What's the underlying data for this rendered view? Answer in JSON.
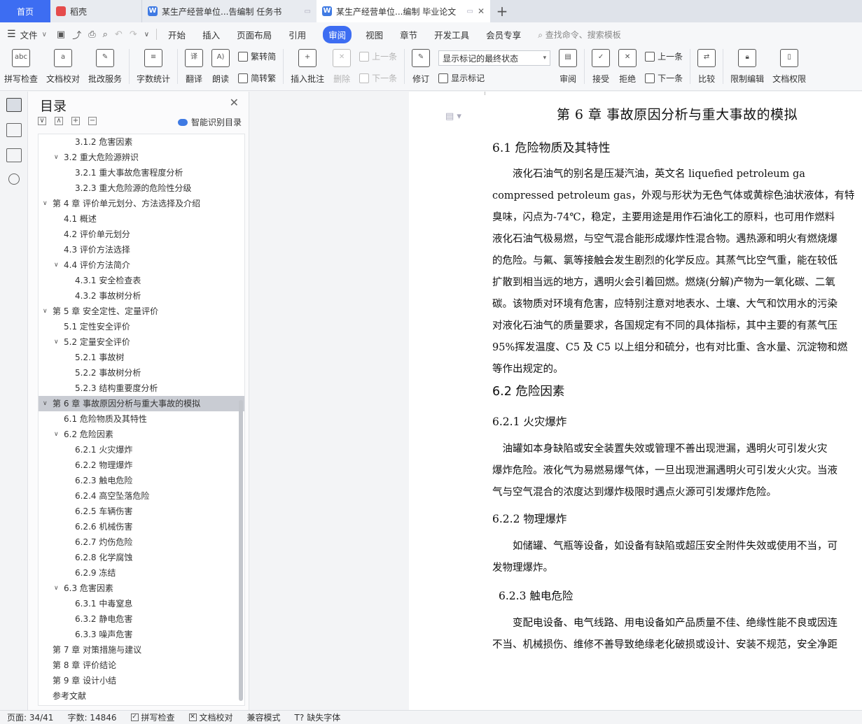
{
  "tabs": {
    "home": "首页",
    "t1": "稻壳",
    "t2": "某生产经营单位...告编制 任务书",
    "t3": "某生产经营单位...编制 毕业论文",
    "add": "+"
  },
  "menu": {
    "file": "文件",
    "items": [
      "开始",
      "插入",
      "页面布局",
      "引用"
    ],
    "active": "审阅",
    "items2": [
      "视图",
      "章节",
      "开发工具",
      "会员专享"
    ],
    "search": "查找命令、搜索模板"
  },
  "ribbon": {
    "spell": "拼写检查",
    "doccheck": "文档校对",
    "review_service": "批改服务",
    "wordcount": "字数统计",
    "translate": "翻译",
    "read": "朗读",
    "trad": "繁转简",
    "simp": "简转繁",
    "insert_comment": "插入批注",
    "delete": "删除",
    "prev": "上一条",
    "next": "下一条",
    "revise": "修订",
    "markup_select": "显示标记的最终状态",
    "show_markup": "显示标记",
    "review": "审阅",
    "accept": "接受",
    "reject": "拒绝",
    "prev2": "上一条",
    "next2": "下一条",
    "compare": "比较",
    "restrict": "限制编辑",
    "doc_perm": "文档权限"
  },
  "toc": {
    "title": "目录",
    "close": "✕",
    "smart": "智能识别目录",
    "items": [
      {
        "level": 3,
        "text": "3.1.2 危害因素",
        "caret": ""
      },
      {
        "level": 2,
        "text": "3.2 重大危险源辨识",
        "caret": "∨"
      },
      {
        "level": 3,
        "text": "3.2.1 重大事故危害程度分析",
        "caret": ""
      },
      {
        "level": 3,
        "text": "3.2.3 重大危险源的危险性分级",
        "caret": ""
      },
      {
        "level": 1,
        "text": "第 4 章 评价单元划分、方法选择及介绍",
        "caret": "∨"
      },
      {
        "level": 2,
        "text": "4.1 概述",
        "caret": ""
      },
      {
        "level": 2,
        "text": "4.2 评价单元划分",
        "caret": ""
      },
      {
        "level": 2,
        "text": "4.3 评价方法选择",
        "caret": ""
      },
      {
        "level": 2,
        "text": "4.4 评价方法简介",
        "caret": "∨"
      },
      {
        "level": 3,
        "text": "4.3.1 安全检查表",
        "caret": ""
      },
      {
        "level": 3,
        "text": "4.3.2 事故树分析",
        "caret": ""
      },
      {
        "level": 1,
        "text": "第 5 章 安全定性、定量评价",
        "caret": "∨"
      },
      {
        "level": 2,
        "text": "5.1 定性安全评价",
        "caret": ""
      },
      {
        "level": 2,
        "text": "5.2 定量安全评价",
        "caret": "∨"
      },
      {
        "level": 3,
        "text": "5.2.1 事故树",
        "caret": ""
      },
      {
        "level": 3,
        "text": "5.2.2 事故树分析",
        "caret": ""
      },
      {
        "level": 3,
        "text": "5.2.3 结构重要度分析",
        "caret": ""
      },
      {
        "level": 1,
        "text": "第 6 章 事故原因分析与重大事故的模拟",
        "caret": "∨",
        "selected": true
      },
      {
        "level": 2,
        "text": "6.1 危险物质及其特性",
        "caret": ""
      },
      {
        "level": 2,
        "text": "6.2 危险因素",
        "caret": "∨"
      },
      {
        "level": 3,
        "text": "6.2.1 火灾爆炸",
        "caret": ""
      },
      {
        "level": 3,
        "text": "6.2.2 物理爆炸",
        "caret": ""
      },
      {
        "level": 3,
        "text": "6.2.3 触电危险",
        "caret": ""
      },
      {
        "level": 3,
        "text": "6.2.4 高空坠落危险",
        "caret": ""
      },
      {
        "level": 3,
        "text": "6.2.5 车辆伤害",
        "caret": ""
      },
      {
        "level": 3,
        "text": "6.2.6 机械伤害",
        "caret": ""
      },
      {
        "level": 3,
        "text": "6.2.7 灼伤危险",
        "caret": ""
      },
      {
        "level": 3,
        "text": "6.2.8 化学腐蚀",
        "caret": ""
      },
      {
        "level": 3,
        "text": "6.2.9 冻结",
        "caret": ""
      },
      {
        "level": 2,
        "text": "6.3 危害因素",
        "caret": "∨"
      },
      {
        "level": 3,
        "text": "6.3.1 中毒窒息",
        "caret": ""
      },
      {
        "level": 3,
        "text": "6.3.2 静电危害",
        "caret": ""
      },
      {
        "level": 3,
        "text": "6.3.3 噪声危害",
        "caret": ""
      },
      {
        "level": 1,
        "text": "第 7 章 对策措施与建议",
        "caret": ""
      },
      {
        "level": 1,
        "text": "第 8 章 评价结论",
        "caret": ""
      },
      {
        "level": 1,
        "text": "第 9 章 设计小结",
        "caret": ""
      },
      {
        "level": 1,
        "text": "参考文献",
        "caret": ""
      }
    ]
  },
  "doc": {
    "chapter": "第 6 章  事故原因分析与重大事故的模拟",
    "s61": "6.1 危险物质及其特性",
    "p61": [
      "　　液化石油气的别名是压凝汽油，英文名 liquefied petroleum ga",
      "compressed petroleum gas，外观与形状为无色气体或黄棕色油状液体，有特",
      "臭味，闪点为-74℃，稳定，主要用途是用作石油化工的原料，也可用作燃料",
      "液化石油气极易燃，与空气混合能形成爆炸性混合物。遇热源和明火有燃烧爆",
      "的危险。与氟、氯等接触会发生剧烈的化学反应。其蒸气比空气重，能在较低",
      "扩散到相当远的地方，遇明火会引着回燃。燃烧(分解)产物为一氧化碳、二氧",
      "碳。该物质对环境有危害，应特别注意对地表水、土壤、大气和饮用水的污染",
      "对液化石油气的质量要求，各国规定有不同的具体指标，其中主要的有蒸气压",
      "95%挥发温度、C5 及 C5 以上组分和硫分，也有对比重、含水量、沉淀物和燃",
      "等作出规定的。"
    ],
    "s62": "6.2 危险因素",
    "s621": "6.2.1 火灾爆炸",
    "p621": [
      "　油罐如本身缺陷或安全装置失效或管理不善出现泄漏，遇明火可引发火灾",
      "爆炸危险。液化气为易燃易爆气体，一旦出现泄漏遇明火可引发火火灾。当液",
      "气与空气混合的浓度达到爆炸极限时遇点火源可引发爆炸危险。"
    ],
    "s622": "6.2.2 物理爆炸",
    "p622": [
      "　　如储罐、气瓶等设备，如设备有缺陷或超压安全附件失效或使用不当，可",
      "发物理爆炸。"
    ],
    "s623": "6.2.3 触电危险",
    "p623": [
      "　　变配电设备、电气线路、用电设备如产品质量不佳、绝缘性能不良或因连",
      "不当、机械损伤、维修不善导致绝缘老化破损或设计、安装不规范，安全净距"
    ]
  },
  "status": {
    "page": "页面: 34/41",
    "words": "字数: 14846",
    "spell": "拼写检查",
    "doccheck": "文档校对",
    "compat": "兼容模式",
    "missing_font": "缺失字体"
  }
}
